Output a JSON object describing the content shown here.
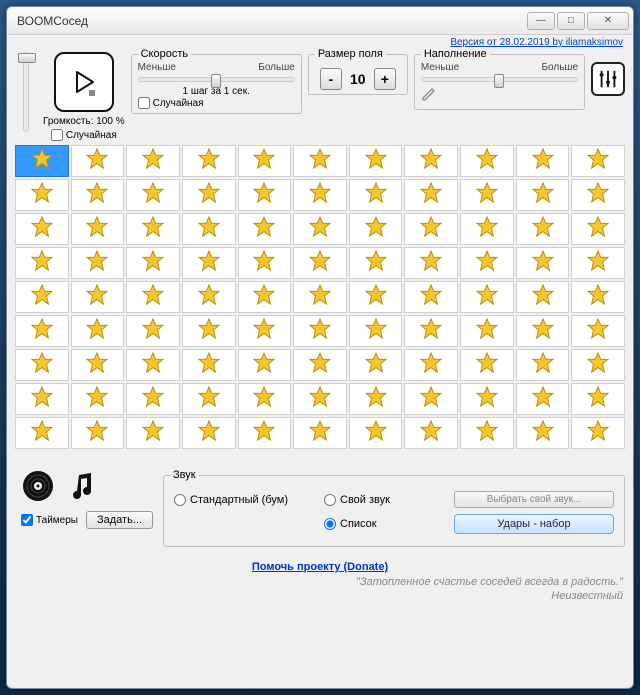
{
  "window": {
    "title": "ВООМСосед"
  },
  "version_link": "Версия от 28.02.2019 by iliamaksimov",
  "volume": {
    "label": "Громкость: 100 %",
    "random_label": "Случайная",
    "random_checked": false
  },
  "speed": {
    "legend": "Скорость",
    "min_label": "Меньше",
    "max_label": "Больше",
    "step_text": "1 шаг за 1 сек.",
    "random_label": "Случайная",
    "random_checked": false,
    "thumb_pct": 50
  },
  "field_size": {
    "legend": "Размер поля",
    "value": "10",
    "minus": "-",
    "plus": "+"
  },
  "fill": {
    "legend": "Наполнение",
    "min_label": "Меньше",
    "max_label": "Больше",
    "thumb_pct": 50
  },
  "grid": {
    "rows": 9,
    "cols": 11,
    "selected_row": 0,
    "selected_col": 0
  },
  "timers": {
    "label": "Таймеры",
    "checked": true,
    "set_button": "Задать..."
  },
  "sound": {
    "legend": "Звук",
    "options": {
      "standard": "Стандартный (бум)",
      "custom": "Свой звук",
      "list": "Список"
    },
    "selected": "list",
    "choose_button": "Выбрать свой звук...",
    "hits_button": "Удары - набор"
  },
  "donate_link": "Помочь проекту (Donate)",
  "quote": {
    "text": "\"Затопленное счастье соседей всегда в радость.\"",
    "author": "Неизвестный"
  }
}
